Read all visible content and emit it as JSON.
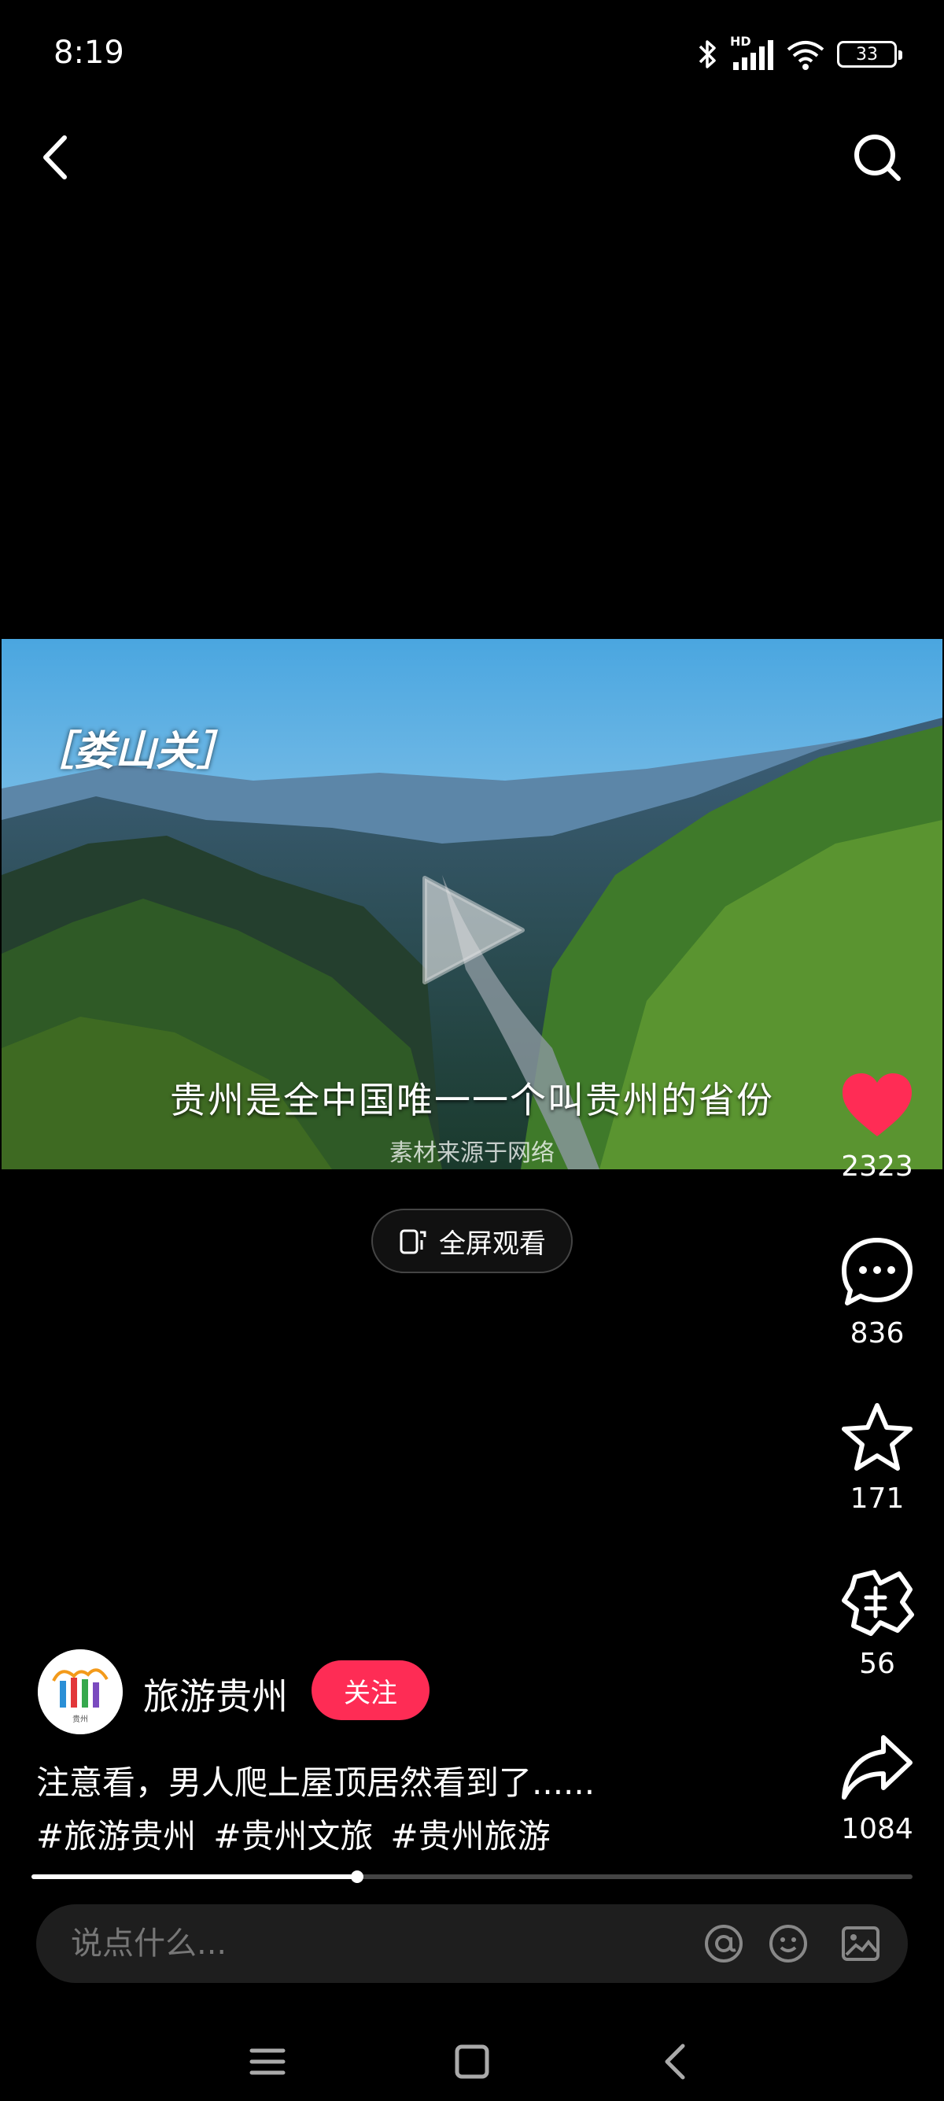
{
  "status_bar": {
    "time": "8:19",
    "network_label": "HD",
    "battery": "33"
  },
  "video": {
    "tag": "［娄山关］",
    "caption": "贵州是全中国唯一一个叫贵州的省份",
    "source": "素材来源于网络"
  },
  "fullscreen": {
    "label": "全屏观看"
  },
  "actions": {
    "like_count": "2323",
    "comment_count": "836",
    "favorite_count": "171",
    "gift_count": "56",
    "share_count": "1084"
  },
  "author": {
    "name": "旅游贵州",
    "follow_label": "关注",
    "avatar_text": "贵州"
  },
  "post": {
    "description": "注意看，男人爬上屋顶居然看到了......",
    "hashtags": [
      "#旅游贵州",
      "#贵州文旅",
      "#贵州旅游"
    ]
  },
  "progress": {
    "fraction": 0.37
  },
  "comment": {
    "placeholder": "说点什么..."
  },
  "colors": {
    "accent": "#fe2c55",
    "like": "#ff2c55",
    "background": "#000000"
  },
  "icons": [
    "back-icon",
    "search-icon",
    "play-icon",
    "heart-icon",
    "comment-icon",
    "star-icon",
    "gift-icon",
    "share-icon",
    "at-icon",
    "emoji-icon",
    "image-icon",
    "menu-icon",
    "home-icon",
    "nav-back-icon"
  ]
}
